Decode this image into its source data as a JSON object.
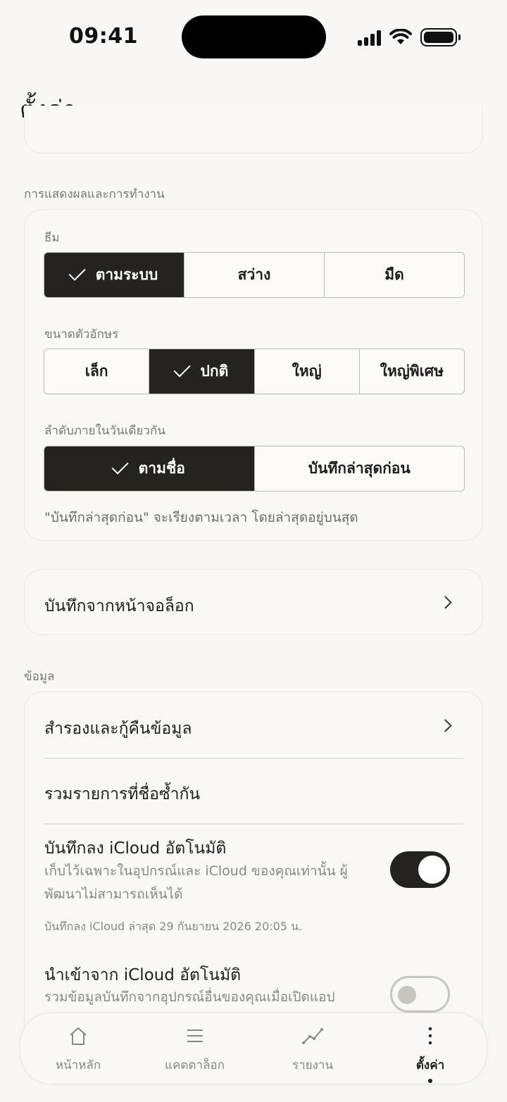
{
  "status_bar": {
    "time": "09:41"
  },
  "header": {
    "title": "ตั้งค่า"
  },
  "display_section": {
    "label": "การแสดงผลและการทำงาน",
    "theme": {
      "label": "ธีม",
      "options": [
        "ตามระบบ",
        "สว่าง",
        "มืด"
      ],
      "selected": "ตามระบบ"
    },
    "font_size": {
      "label": "ขนาดตัวอักษร",
      "options": [
        "เล็ก",
        "ปกติ",
        "ใหญ่",
        "ใหญ่พิเศษ"
      ],
      "selected": "ปกติ"
    },
    "order": {
      "label": "ลำดับภายในวันเดียวกัน",
      "options": [
        "ตามชื่อ",
        "บันทึกล่าสุดก่อน"
      ],
      "selected": "ตามชื่อ",
      "hint": "\"บันทึกล่าสุดก่อน\" จะเรียงตามเวลา โดยล่าสุดอยู่บนสุด"
    }
  },
  "lock_screen": {
    "label": "บันทึกจากหน้าจอล็อก"
  },
  "data_section": {
    "label": "ข้อมูล",
    "backup": {
      "label": "สำรองและกู้คืนข้อมูล"
    },
    "merge": {
      "label": "รวมรายการที่ชื่อซ้ำกัน"
    },
    "icloud_save": {
      "label": "บันทึกลง iCloud อัตโนมัติ",
      "description": "เก็บไว้เฉพาะในอุปกรณ์และ iCloud ของคุณเท่านั้น ผู้พัฒนาไม่สามารถเห็นได้",
      "meta": "บันทึกลง iCloud ล่าสุด 29 กันยายน 2026 20:05 น.",
      "enabled": true
    },
    "icloud_import": {
      "label": "นำเข้าจาก iCloud อัตโนมัติ",
      "description": "รวมข้อมูลบันทึกจากอุปกรณ์อื่นของคุณเมื่อเปิดแอป",
      "enabled": false
    }
  },
  "tabbar": {
    "items": [
      {
        "label": "หน้าหลัก",
        "icon": "home-icon"
      },
      {
        "label": "แคตตาล็อก",
        "icon": "list-icon"
      },
      {
        "label": "รายงาน",
        "icon": "chart-line-icon"
      },
      {
        "label": "ตั้งค่า",
        "icon": "more-vertical-icon"
      }
    ],
    "active": "ตั้งค่า"
  }
}
